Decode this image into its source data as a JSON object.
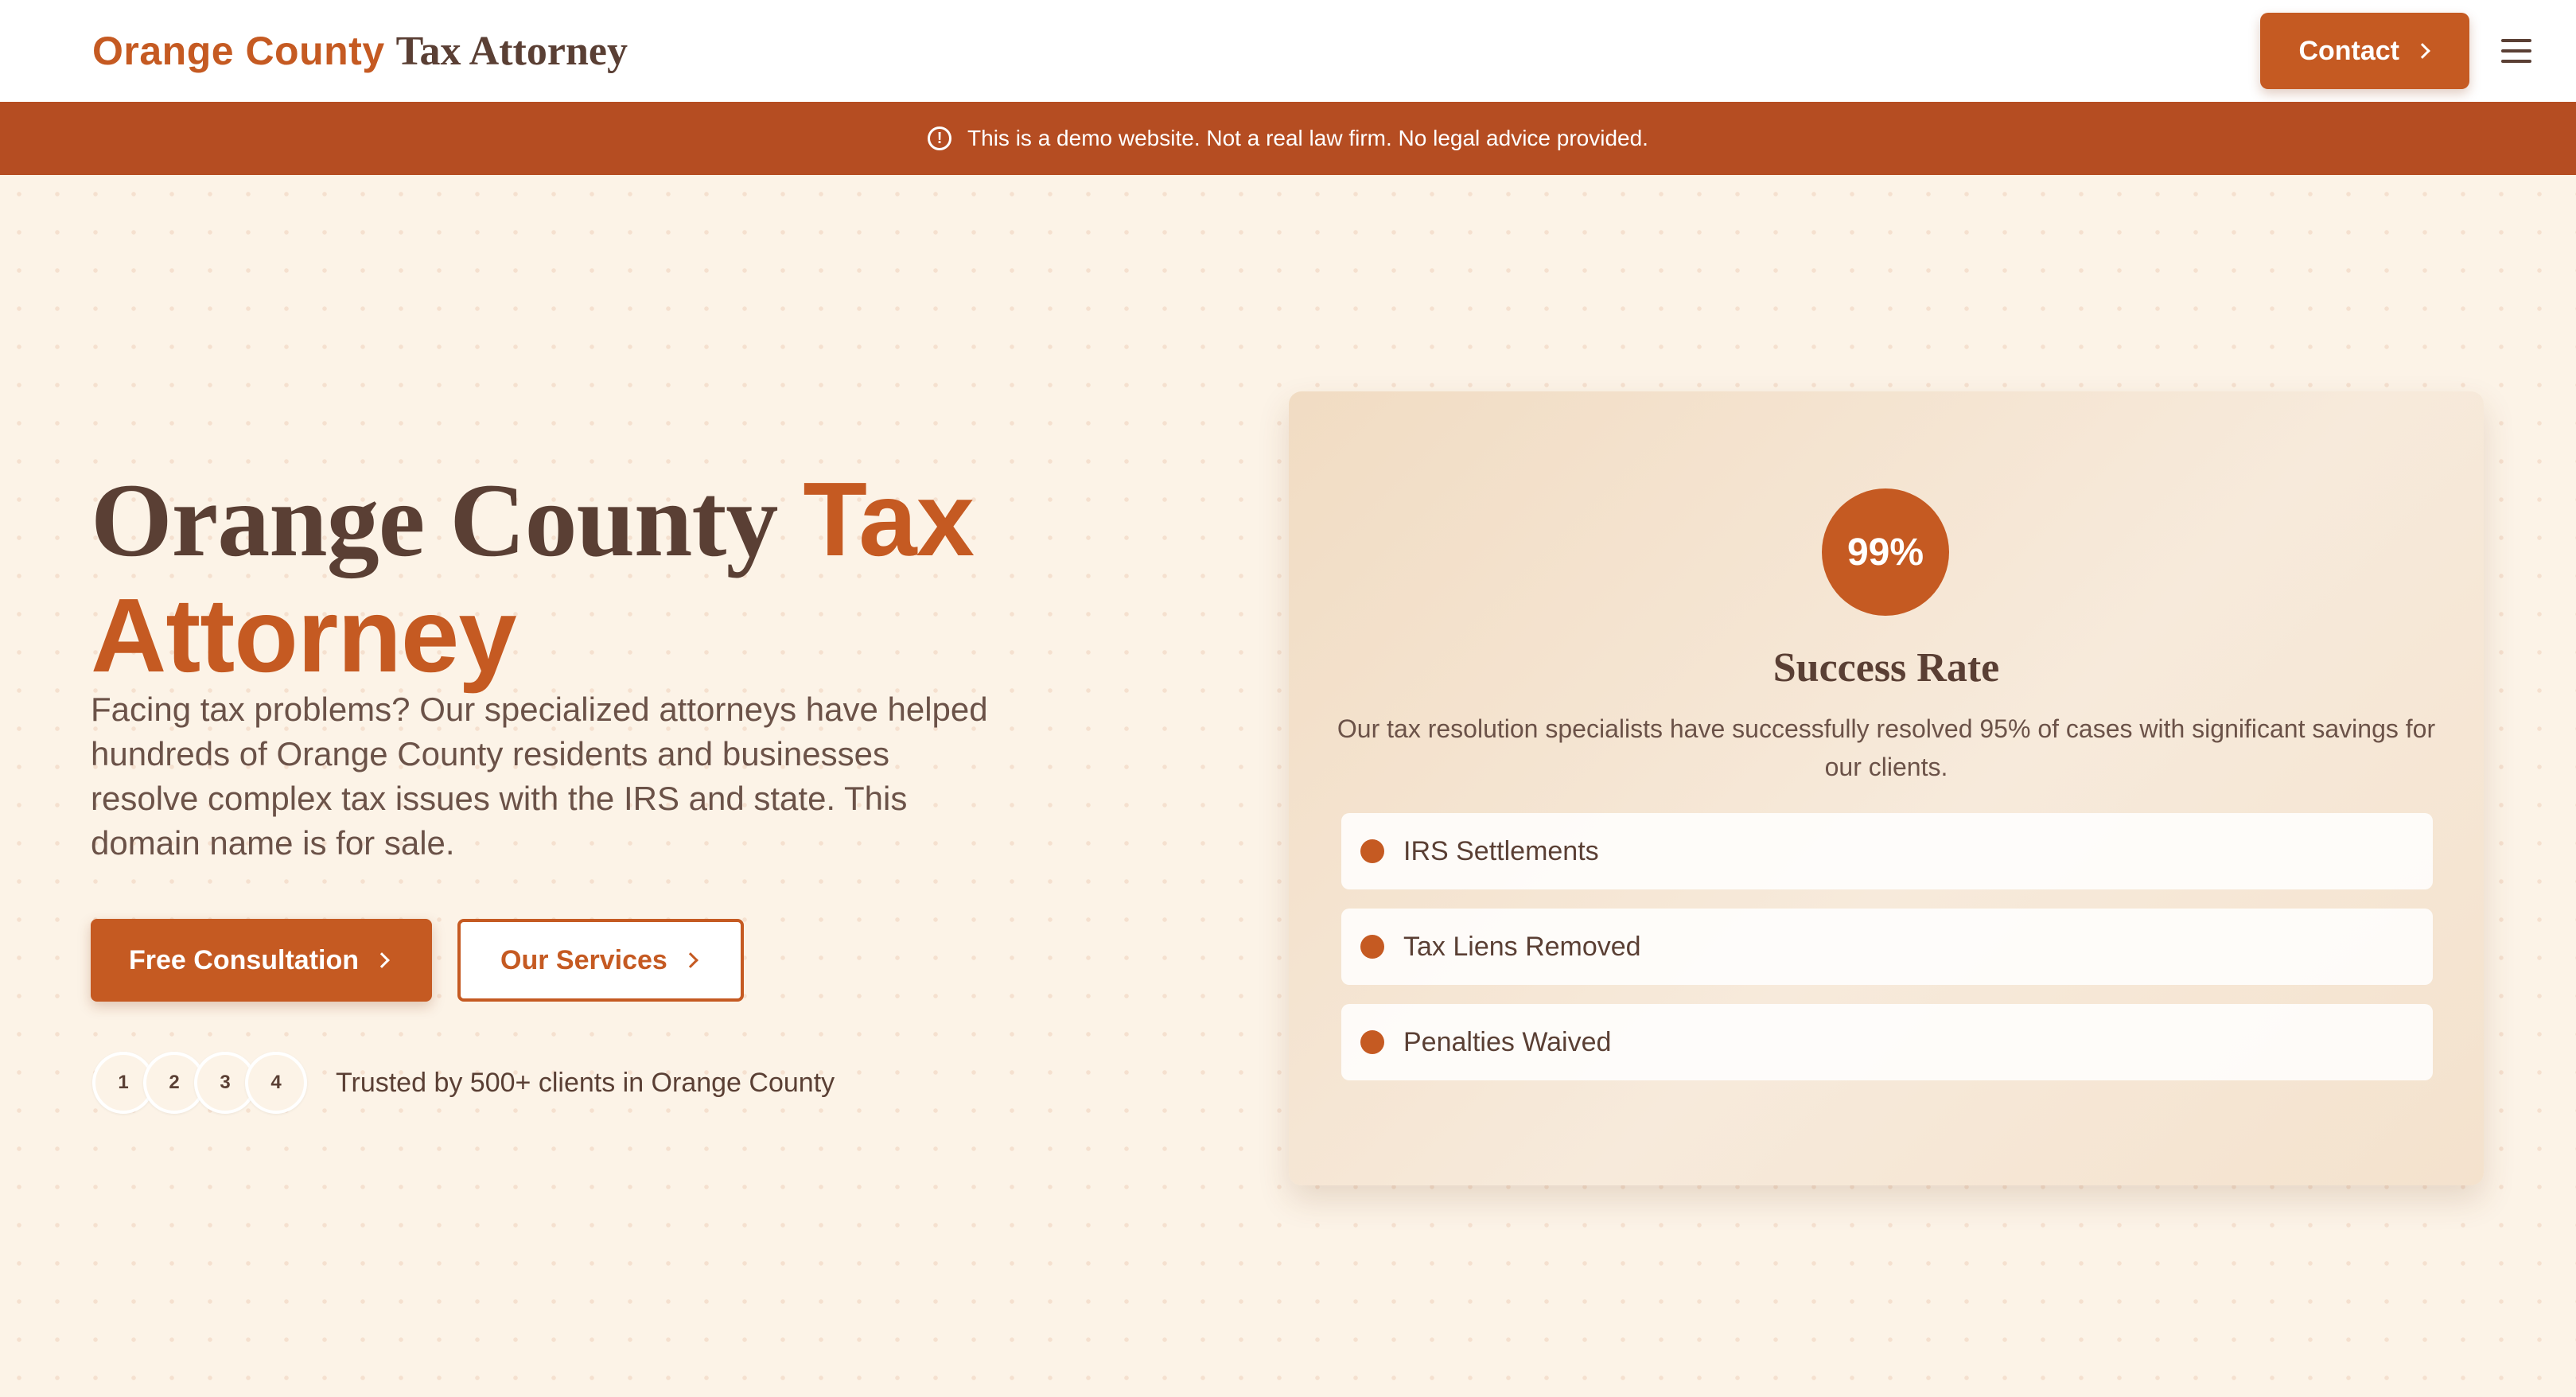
{
  "header": {
    "logo_main": "Orange County",
    "logo_sub": "Tax Attorney",
    "contact_label": "Contact"
  },
  "banner": {
    "text": "This is a demo website. Not a real law firm. No legal advice provided."
  },
  "hero": {
    "title_part1": "Orange County ",
    "title_accent_1": "Tax",
    "title_accent_2": "Attorney",
    "description": "Facing tax problems? Our specialized attorneys have helped hundreds of Orange County residents and businesses resolve complex tax issues with the IRS and state. This domain name is for sale.",
    "primary_button": "Free Consultation",
    "secondary_button": "Our Services",
    "avatars": [
      "1",
      "2",
      "3",
      "4"
    ],
    "trust_text": "Trusted by 500+ clients in Orange County"
  },
  "card": {
    "badge": "99%",
    "title": "Success Rate",
    "description": "Our tax resolution specialists have successfully resolved 95% of cases with significant savings for our clients.",
    "items": [
      "IRS Settlements",
      "Tax Liens Removed",
      "Penalties Waived"
    ]
  },
  "colors": {
    "accent": "#c55a22",
    "banner": "#b54d22",
    "text": "#5a3f34",
    "background": "#fcf3e7"
  },
  "icons": {
    "contact": "chevron-right-icon",
    "menu": "hamburger-menu-icon",
    "banner": "info-circle-icon"
  }
}
